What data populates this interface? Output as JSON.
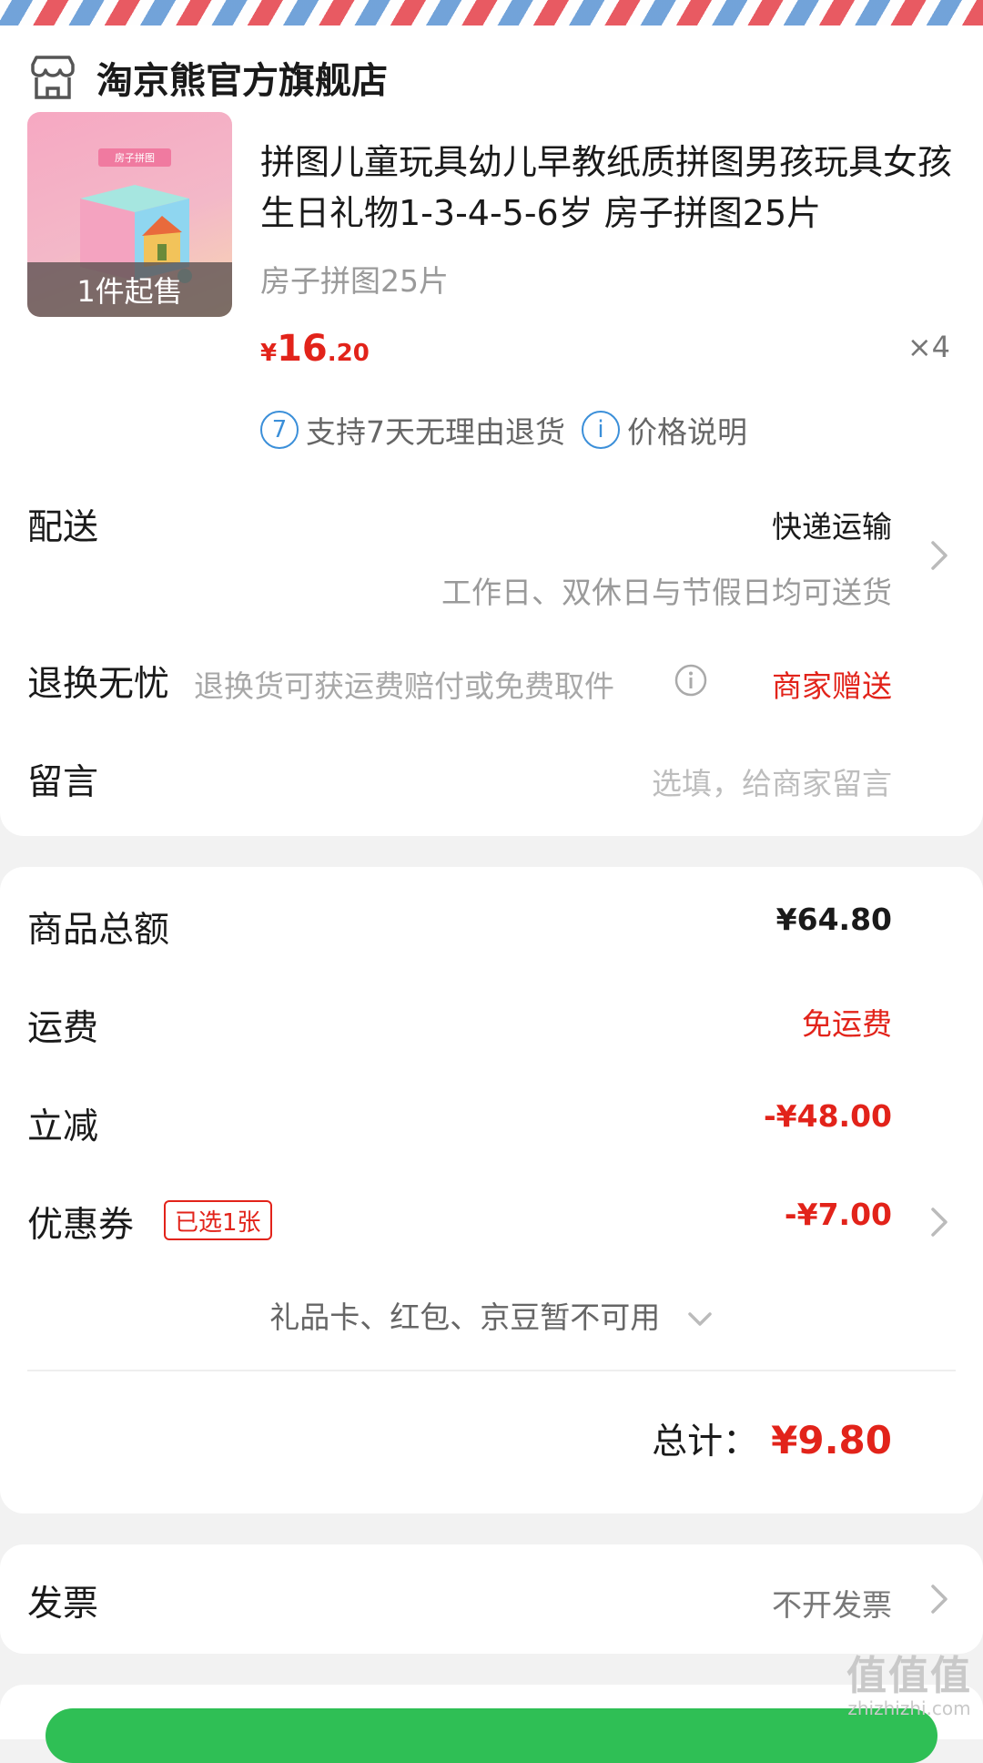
{
  "shop": {
    "name": "淘京熊官方旗舰店",
    "icon": "store-icon"
  },
  "product": {
    "badge": "1件起售",
    "title": "拼图儿童玩具幼儿早教纸质拼图男孩玩具女孩生日礼物1-3-4-5-6岁 房子拼图25片",
    "spec": "房子拼图25片",
    "price_symbol": "¥",
    "price_int": "16",
    "price_dec": ".20",
    "quantity": "×4",
    "thumb_label": "房子拼图"
  },
  "services": {
    "return_badge": "7",
    "return_text": "支持7天无理由退货",
    "price_info_badge": "i",
    "price_info_text": "价格说明"
  },
  "delivery": {
    "label": "配送",
    "value": "快递运输",
    "sub": "工作日、双休日与节假日均可送货"
  },
  "return_ins": {
    "label": "退换无忧",
    "desc": "退换货可获运费赔付或免费取件",
    "value": "商家赠送"
  },
  "message": {
    "label": "留言",
    "placeholder": "选填，给商家留言"
  },
  "summary": {
    "goods_total_label": "商品总额",
    "goods_total_value": "¥64.80",
    "shipping_label": "运费",
    "shipping_value": "免运费",
    "discount_label": "立减",
    "discount_value": "-¥48.00",
    "coupon_label": "优惠券",
    "coupon_tag": "已选1张",
    "coupon_value": "-¥7.00",
    "unavailable_text": "礼品卡、红包、京豆暂不可用",
    "total_label": "总计：",
    "total_value": "¥9.80"
  },
  "invoice": {
    "label": "发票",
    "value": "不开发票"
  },
  "watermark": {
    "mark": "值值值",
    "url": "zhizhizhi.com"
  },
  "colors": {
    "accent_red": "#e2231a",
    "info_blue": "#3b8fd9",
    "green": "#2fbf55"
  }
}
